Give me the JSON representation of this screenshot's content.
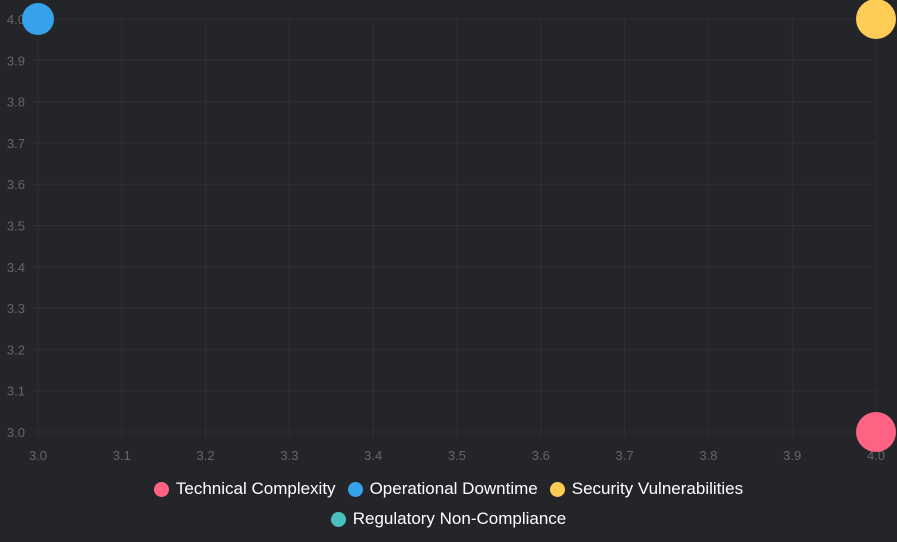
{
  "chart_data": {
    "type": "bubble",
    "title": "",
    "xlabel": "",
    "ylabel": "",
    "xlim": [
      3.0,
      4.0
    ],
    "ylim": [
      3.0,
      4.0
    ],
    "x_ticks": [
      "3.0",
      "3.1",
      "3.2",
      "3.3",
      "3.4",
      "3.5",
      "3.6",
      "3.7",
      "3.8",
      "3.9",
      "4.0"
    ],
    "y_ticks": [
      "3.0",
      "3.1",
      "3.2",
      "3.3",
      "3.4",
      "3.5",
      "3.6",
      "3.7",
      "3.8",
      "3.9",
      "4.0"
    ],
    "grid": true,
    "legend_position": "bottom",
    "series": [
      {
        "name": "Technical Complexity",
        "color": "#ff6384",
        "points": [
          {
            "x": 4.0,
            "y": 3.0,
            "r": 20
          }
        ]
      },
      {
        "name": "Operational Downtime",
        "color": "#36a2eb",
        "points": [
          {
            "x": 3.0,
            "y": 4.0,
            "r": 16
          }
        ]
      },
      {
        "name": "Security Vulnerabilities",
        "color": "#ffcd56",
        "points": [
          {
            "x": 4.0,
            "y": 4.0,
            "r": 20
          }
        ]
      },
      {
        "name": "Regulatory Non-Compliance",
        "color": "#4bc0c0",
        "points": []
      }
    ]
  }
}
